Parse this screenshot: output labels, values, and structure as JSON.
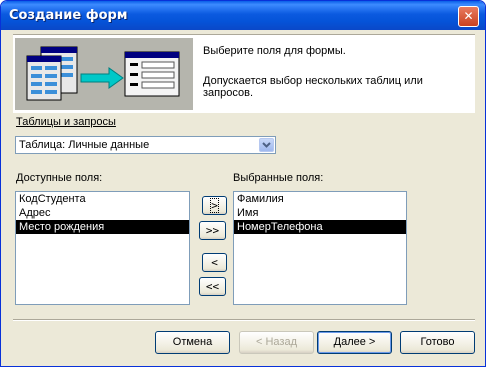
{
  "window": {
    "title": "Создание форм",
    "close_glyph": "✕"
  },
  "header": {
    "line1": "Выберите поля для формы.",
    "line2": "Допускается выбор нескольких таблиц или запросов."
  },
  "tables": {
    "label": "Таблицы и запросы",
    "selected": "Таблица: Личные данные"
  },
  "available": {
    "label": "Доступные поля:",
    "items": [
      "КодСтудента",
      "Адрес",
      "Место рождения"
    ],
    "selected_index": 2
  },
  "chosen": {
    "label": "Выбранные поля:",
    "items": [
      "Фамилия",
      "Имя",
      "НомерТелефона"
    ],
    "selected_index": 2
  },
  "move_buttons": {
    "add_one": ">",
    "add_all": ">>",
    "remove_one": "<",
    "remove_all": "<<"
  },
  "footer": {
    "cancel": "Отмена",
    "back": "< Назад",
    "next": "Далее >",
    "finish": "Готово"
  },
  "colors": {
    "titlebar": "#0553d8",
    "dialog_bg": "#ece9d8",
    "selection": "#000000"
  }
}
